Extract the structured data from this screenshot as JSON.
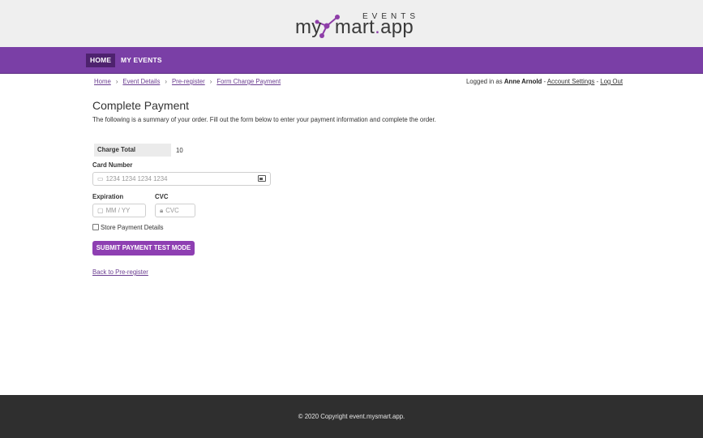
{
  "brand": {
    "logo_top": "EVENTS",
    "logo_my": "my",
    "logo_s": "S",
    "logo_mart": "mart",
    "logo_dot": ".",
    "logo_app": "app",
    "accent": "#7a3fa6"
  },
  "nav": {
    "items": [
      {
        "label": "HOME",
        "active": true
      },
      {
        "label": "MY EVENTS",
        "active": false
      }
    ]
  },
  "breadcrumb": {
    "items": [
      "Home",
      "Event Details",
      "Pre-register",
      "Form Charge Payment"
    ],
    "separator": "›"
  },
  "user": {
    "prefix": "Logged in as ",
    "name": "Anne Arnold",
    "dash1": " - ",
    "account_settings": "Account Settings",
    "dash2": " - ",
    "logout": "Log Out"
  },
  "page": {
    "title": "Complete Payment",
    "intro": "The following is a summary of your order. Fill out the form below to enter your payment information and complete the order."
  },
  "summary": {
    "charge_label": "Charge Total",
    "charge_value": "10"
  },
  "form": {
    "card_number_label": "Card Number",
    "card_number_placeholder": "1234 1234 1234 1234",
    "expiration_label": "Expiration",
    "expiration_placeholder": "MM / YY",
    "cvc_label": "CVC",
    "cvc_placeholder": "CVC",
    "store_details_label": "Store Payment Details",
    "store_details_checked": false,
    "submit_label": "SUBMIT PAYMENT TEST MODE"
  },
  "links": {
    "back": "Back to Pre-register"
  },
  "footer": {
    "copyright": "© 2020 Copyright event.mysmart.app."
  }
}
